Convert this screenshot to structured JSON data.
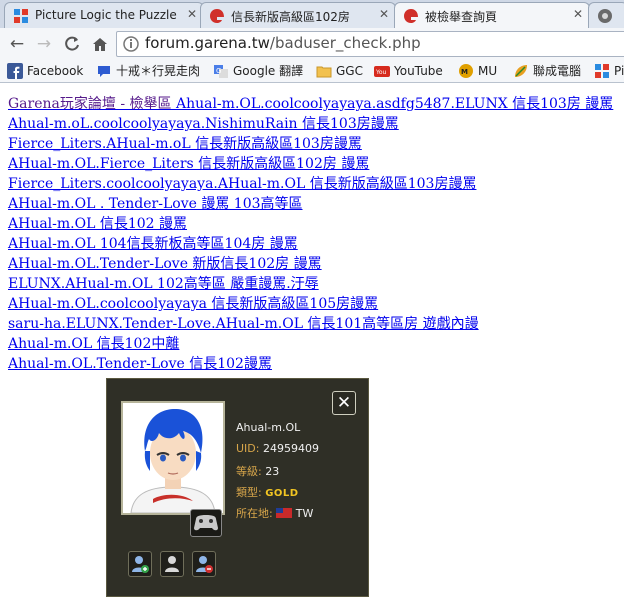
{
  "tabs": [
    {
      "label": "Picture Logic the Puzzle G",
      "active": false
    },
    {
      "label": "信長新版高級區102房",
      "active": false
    },
    {
      "label": "被檢舉查詢頁",
      "active": true
    }
  ],
  "address": {
    "host": "forum.garena.tw",
    "path": "/baduser_check.php"
  },
  "bookmarks": [
    {
      "label": "Facebook",
      "icon": "facebook-icon"
    },
    {
      "label": "十戒＊行晃走肉",
      "icon": "chat-icon"
    },
    {
      "label": "Google 翻譯",
      "icon": "translate-icon"
    },
    {
      "label": "GGC",
      "icon": "folder-icon"
    },
    {
      "label": "YouTube",
      "icon": "youtube-icon"
    },
    {
      "label": "MU",
      "icon": "mu-icon"
    },
    {
      "label": "聯成電腦",
      "icon": "leaf-icon"
    },
    {
      "label": "Pi",
      "icon": "picture-logic-icon"
    }
  ],
  "links": [
    {
      "prefix": "Garena玩家論壇 - 檢舉區",
      "text": " Ahual-m.OL.coolcoolyayaya.asdfg5487.ELUNX 信長103房 謾罵"
    },
    {
      "prefix": "",
      "text": "Ahual-m.oL.coolcoolyayaya.NishimuRain 信長103房謾罵"
    },
    {
      "prefix": "",
      "text": "Fierce_Liters.AHual-m.oL 信長新版高級區103房謾罵"
    },
    {
      "prefix": "",
      "text": "AHual-m.OL.Fierce_Liters 信長新版高級區102房 謾罵"
    },
    {
      "prefix": "",
      "text": "Fierce_Liters.coolcoolyayaya.AHual-m.OL 信長新版高級區103房謾罵"
    },
    {
      "prefix": "",
      "text": "AHual-m.OL . Tender-Love 謾罵 103高等區"
    },
    {
      "prefix": "",
      "text": "AHual-m.OL 信長102 謾罵"
    },
    {
      "prefix": "",
      "text": "AHual-m.OL 104信長新板高等區104房 謾罵"
    },
    {
      "prefix": "",
      "text": "AHual-m.OL.Tender-Love 新版信長102房 謾罵"
    },
    {
      "prefix": "",
      "text": "ELUNX.AHual-m.OL 102高等區 嚴重謾罵.汙辱"
    },
    {
      "prefix": "",
      "text": "AHual-m.OL.coolcoolyayaya 信長新版高級區105房謾罵"
    },
    {
      "prefix": "",
      "text": "saru-ha.ELUNX.Tender-Love.AHual-m.OL 信長101高等區房 遊戲內謾"
    },
    {
      "prefix": "",
      "text": "Ahual-m.OL 信長102中離"
    },
    {
      "prefix": "",
      "text": "Ahual-m.OL.Tender-Love 信長102謾罵"
    }
  ],
  "profile": {
    "username": "Ahual-m.OL",
    "uid_label": "UID:",
    "uid": "24959409",
    "level_label": "等級:",
    "level": "23",
    "type_label": "類型:",
    "type": "GOLD",
    "location_label": "所在地:",
    "location": "TW"
  },
  "colors": {
    "link": "#0000ee",
    "visited": "#551a8b",
    "card_bg": "#2f2f26",
    "label": "#d8a64a",
    "gold": "#f2c522"
  }
}
